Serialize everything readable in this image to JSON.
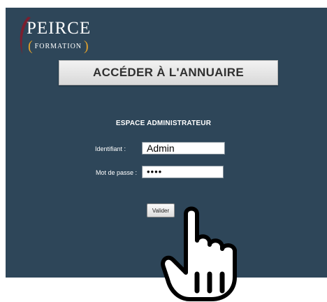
{
  "logo": {
    "name": "PEIRCE",
    "subtitle": "FORMATION",
    "paren_open": "(",
    "paren_close": ")"
  },
  "annuaire_button": {
    "label": "ACCÉDER À L'ANNUAIRE"
  },
  "admin_section": {
    "title": "ESPACE ADMINISTRATEUR",
    "identifiant_label": "Identifiant :",
    "identifiant_value": "Admin",
    "password_label": "Mot de passe :",
    "password_value": "••••",
    "submit_label": "Valider"
  },
  "colors": {
    "panel_bg": "#2e4659",
    "accent": "#e3a22c",
    "swoosh": "#7a1f2f"
  },
  "icons": {
    "cursor": "pointing-hand-icon"
  }
}
